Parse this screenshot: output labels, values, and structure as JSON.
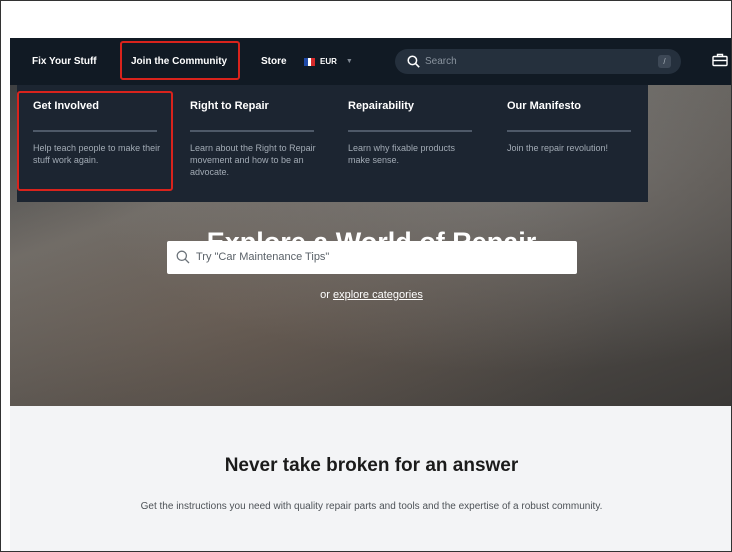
{
  "nav": {
    "fix_your_stuff": "Fix Your Stuff",
    "join_community": "Join the Community",
    "store": "Store",
    "currency": "EUR",
    "search_placeholder": "Search",
    "search_shortcut": "/",
    "icons": [
      "search-icon",
      "toolbox-icon",
      "france-flag-icon",
      "chevron-down-icon"
    ]
  },
  "dropdown": {
    "columns": [
      {
        "title": "Get Involved",
        "description": "Help teach people to make their stuff work again."
      },
      {
        "title": "Right to Repair",
        "description": "Learn about the Right to Repair movement and how to be an advocate."
      },
      {
        "title": "Repairability",
        "description": "Learn why fixable products make sense."
      },
      {
        "title": "Our Manifesto",
        "description": "Join the repair revolution!"
      }
    ]
  },
  "hero": {
    "title": "Explore a World of Repair",
    "search_placeholder": "Try \"Car Maintenance Tips\"",
    "explore_prefix": "or ",
    "explore_link": "explore categories"
  },
  "lower": {
    "title": "Never take broken for an answer",
    "subtitle": "Get the instructions you need with quality repair parts and tools and the expertise of a robust community."
  },
  "colors": {
    "nav_bg": "#111a24",
    "dropdown_bg": "#1c2531",
    "highlight": "#d9231c",
    "lower_bg": "#f3f4f6"
  }
}
